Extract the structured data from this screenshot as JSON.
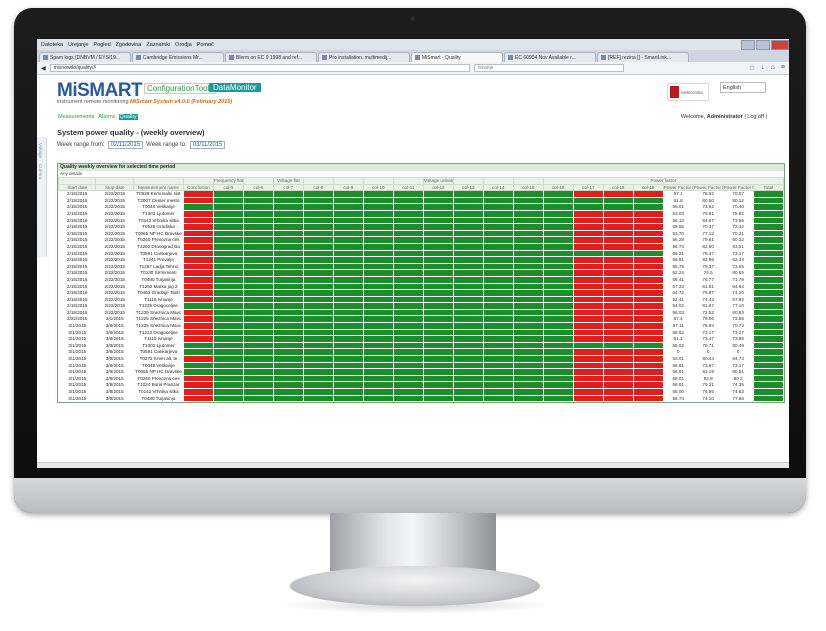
{
  "browser": {
    "menu": [
      "Datoteka",
      "Urejanje",
      "Pogled",
      "Zgodovina",
      "Zaznamki",
      "Orodja",
      "Pomoč"
    ],
    "tabs": [
      {
        "label": "Spam logs (DNBVM / EYS/19..."
      },
      {
        "label": "Cambridge Emissions Mr..."
      },
      {
        "label": "Blerm on EC 9 1998 and ref..."
      },
      {
        "label": "Pro installation, multimedij..."
      },
      {
        "label": "MiSmart - Quality",
        "active": true
      },
      {
        "label": "EC 60904 Nov Available r..."
      },
      {
        "label": "[REF] rezina [] - SmartLink..."
      }
    ],
    "url": "misnowdo/quality/#",
    "search_placeholder": "Iskanje"
  },
  "app": {
    "logo": "MiSMART",
    "tagline_prefix": "instrument remote monitoring",
    "tagline_version": "MiSmart System v4.0.0 (February 2015)",
    "nav_config": "ConfigurationTools",
    "nav_data": "DataMonitor",
    "brand": "elektronika",
    "language": "English",
    "subnav": [
      "Measurements",
      "Alarms",
      "Quality"
    ],
    "welcome_prefix": "Welcome,",
    "user": "Administrator",
    "logout": "Log off",
    "sidestrip": [
      "Voltage",
      "Current"
    ]
  },
  "page": {
    "title": "System power quality - (weekly overview)",
    "range_from_label": "Week range from:",
    "range_from": "02/11/2015",
    "range_to_label": "Week range to:",
    "range_to": "03/11/2015"
  },
  "quality": {
    "header": "Quality weekly overview for selected time period",
    "subheader": "Any details",
    "group_headers": [
      "",
      "",
      "",
      "",
      "Frequency flat",
      "",
      "Voltage flat",
      "",
      "",
      "",
      "",
      "Voltage unbalance",
      "",
      "",
      "",
      "Power factor"
    ],
    "columns": [
      "Start date",
      "Stop date",
      "Measurement name",
      "Conclusion",
      "col-5",
      "col-6",
      "col-7",
      "col-8",
      "col-9",
      "col-10",
      "col-11",
      "col-12",
      "col-13",
      "col-14",
      "col-15",
      "col-16",
      "col-17",
      "col-18",
      "col-19",
      "Power Factor L1",
      "Power Factor L2",
      "Power Factor L3",
      "Total"
    ],
    "rows": [
      {
        "start": "2/15/2015",
        "stop": "2/22/2015",
        "name": "T0528 Komunalni sist",
        "c": "RGGGGGGGGGGGGRRRNNNG",
        "pf": [
          "57.1",
          "78.62",
          "70.57"
        ]
      },
      {
        "start": "2/15/2015",
        "stop": "2/22/2015",
        "name": "T2007 Center mesto",
        "c": "RGGGGGGGGGGGGGGGNNNG",
        "pf": [
          "51.8",
          "80.50",
          "80.12"
        ]
      },
      {
        "start": "2/15/2015",
        "stop": "2/22/2015",
        "name": "T0048 Velikanje",
        "c": "GGGGGGGGGGGGGGGGNNNG",
        "pf": [
          "55.01",
          "73.52",
          "70.40"
        ]
      },
      {
        "start": "2/15/2015",
        "stop": "2/22/2015",
        "name": "T1303 Ljutomer",
        "c": "RGGGGGGGGGGGGRRRNNNG",
        "pf": [
          "53.03",
          "79.91",
          "75.82"
        ]
      },
      {
        "start": "2/15/2015",
        "stop": "2/22/2015",
        "name": "T0142 Vrhnika sitka",
        "c": "RGGGGGGGGGGGGRRRNNNG",
        "pf": [
          "56.13",
          "84.67",
          "73.56"
        ]
      },
      {
        "start": "2/15/2015",
        "stop": "2/22/2015",
        "name": "T0528 Gradiska",
        "c": "RGGGGGGGGGGGGRRRNNNG",
        "pf": [
          "59.55",
          "70.37",
          "72.32"
        ]
      },
      {
        "start": "2/15/2015",
        "stop": "2/22/2015",
        "name": "T0065 NP HC Dravske",
        "c": "RGGGGGGGGGGGGRRRNNNG",
        "pf": [
          "53.70",
          "77.12",
          "70.21"
        ]
      },
      {
        "start": "2/15/2015",
        "stop": "2/22/2015",
        "name": "T0260 Prevozna ces",
        "c": "RGGGGGGGGGGGGRRRNNNG",
        "pf": [
          "56.28",
          "79.81",
          "80.32"
        ]
      },
      {
        "start": "2/15/2015",
        "stop": "2/22/2015",
        "name": "T1260 Dravograd Ba",
        "c": "RGGGGGGGGGGGGRRRNNNG",
        "pf": [
          "56.74",
          "82.60",
          "83.51"
        ]
      },
      {
        "start": "2/15/2015",
        "stop": "2/22/2015",
        "name": "T0591 Cankarjeva",
        "c": "RGGGGGGGGGGGGGGGNNNG",
        "pf": [
          "56.21",
          "78.37",
          "73.17"
        ]
      },
      {
        "start": "2/15/2015",
        "stop": "2/22/2015",
        "name": "T1241 Prevalje",
        "c": "RGGGGGGGGGGGGRRRNNNG",
        "pf": [
          "59.81",
          "82.98",
          "83.34"
        ]
      },
      {
        "start": "2/15/2015",
        "stop": "2/22/2015",
        "name": "T1267 Ladja Tehno",
        "c": "RGGGGGGGGGGGGRRRNNNG",
        "pf": [
          "55.75",
          "79.37",
          "73.65"
        ]
      },
      {
        "start": "2/15/2015",
        "stop": "2/22/2015",
        "name": "T0130 Strmimenti",
        "c": "RGGGGGGGGGGGGRRRNNNG",
        "pf": [
          "52.24",
          "74.5",
          "80.55"
        ]
      },
      {
        "start": "2/15/2015",
        "stop": "2/22/2015",
        "name": "T0480 Turjasinja",
        "c": "RGGGGGGGGGGGGRRRNNNG",
        "pf": [
          "56.41",
          "76.77",
          "71.79"
        ]
      },
      {
        "start": "2/15/2015",
        "stop": "2/22/2015",
        "name": "T1262 Marka jug 2",
        "c": "RGGGGGGGGGGGGRRRNNNG",
        "pf": [
          "57.23",
          "81.81",
          "84.64"
        ]
      },
      {
        "start": "2/15/2015",
        "stop": "2/22/2015",
        "name": "T0463 Gradisje Tanti",
        "c": "RGGGGGGGGGGGGRRRNNNG",
        "pf": [
          "54.72",
          "76.87",
          "74.20"
        ]
      },
      {
        "start": "2/15/2015",
        "stop": "2/22/2015",
        "name": "T1115 Ivnanje",
        "c": "RGGGGGGGGGGGGRRRNNNG",
        "pf": [
          "52.41",
          "74.44",
          "67.92"
        ]
      },
      {
        "start": "2/15/2015",
        "stop": "2/22/2015",
        "name": "T1225 Dragoceljne",
        "c": "GGGGGGGGGGGGGRRRNNNG",
        "pf": [
          "54.02",
          "81.67",
          "77.10"
        ]
      },
      {
        "start": "2/15/2015",
        "stop": "2/22/2015",
        "name": "T1235 Sneznica Mavc",
        "c": "RGGGGGGGGGGGGRRRNNNG",
        "pf": [
          "56.03",
          "72.52",
          "80.84"
        ]
      },
      {
        "start": "2/22/2015",
        "stop": "3/1/2015",
        "name": "T1225 Sneznica Mavc",
        "c": "RGGGGGGGGGGGGRRRNNNG",
        "pf": [
          "67.4",
          "79.06",
          "73.66"
        ]
      },
      {
        "start": "3/1/2015",
        "stop": "3/8/2015",
        "name": "T1235 Sneznica Mavc",
        "c": "RGGGGGGGGGGGGRRRNNNG",
        "pf": [
          "57.11",
          "79.94",
          "70.73"
        ]
      },
      {
        "start": "3/1/2015",
        "stop": "3/8/2015",
        "name": "T1223 Dragoceljne",
        "c": "RGGGGGGGGGGGGRRRNNNG",
        "pf": [
          "58.52",
          "73.17",
          "73.27"
        ]
      },
      {
        "start": "3/1/2015",
        "stop": "3/8/2015",
        "name": "T1115 Ivnanje",
        "c": "RGGGGGGGGGGGGRRRNNNG",
        "pf": [
          "51.1",
          "73.47",
          "73.95"
        ]
      },
      {
        "start": "3/1/2015",
        "stop": "3/8/2015",
        "name": "T1302 Ljutomer",
        "c": "GGGGGGGGGGGGGGGGNNNG",
        "pf": [
          "55.02",
          "79.71",
          "80.49"
        ]
      },
      {
        "start": "3/1/2015",
        "stop": "3/8/2015",
        "name": "T0591 Cankarjeva",
        "c": "GGGGGGGGGGGGGRRRNNNG",
        "pf": [
          "0",
          "0",
          "0"
        ]
      },
      {
        "start": "3/1/2015",
        "stop": "3/8/2015",
        "name": "T0272 Krem alt. te",
        "c": "RGGGGGGGGGGGGRRRNNNG",
        "pf": [
          "53.01",
          "80.44",
          "84.73"
        ]
      },
      {
        "start": "3/1/2015",
        "stop": "3/8/2015",
        "name": "T0048 Velikanje",
        "c": "GGGGGGGGGGGGGRRRNNNG",
        "pf": [
          "56.91",
          "73.67",
          "73.17"
        ]
      },
      {
        "start": "3/1/2015",
        "stop": "3/8/2015",
        "name": "T0065 NP HC Dravske",
        "c": "GGGGGGGGGGGGGRRRNNNG",
        "pf": [
          "56.91",
          "83.19",
          "80.51"
        ]
      },
      {
        "start": "3/1/2015",
        "stop": "3/8/2015",
        "name": "T0260 Prevozna ces",
        "c": "RGGGGGGGGGGGGRRRNNNG",
        "pf": [
          "59.01",
          "82.8",
          "80.2"
        ]
      },
      {
        "start": "3/1/2015",
        "stop": "3/8/2015",
        "name": "T1024 Boris Pranzar",
        "c": "RGGGGGGGGGGGGRRRNNNG",
        "pf": [
          "56.61",
          "79.31",
          "74.35"
        ]
      },
      {
        "start": "3/1/2015",
        "stop": "3/8/2015",
        "name": "T0142 Vrhnika sitka",
        "c": "RGGGGGGGGGGGGRRRNNNG",
        "pf": [
          "55.00",
          "76.65",
          "74.63"
        ]
      },
      {
        "start": "3/1/2015",
        "stop": "3/8/2015",
        "name": "T0480 Turjasinja",
        "c": "RGGGGGGGGGGGGRRRNNNG",
        "pf": [
          "55.74",
          "74.10",
          "77.66"
        ]
      }
    ]
  }
}
